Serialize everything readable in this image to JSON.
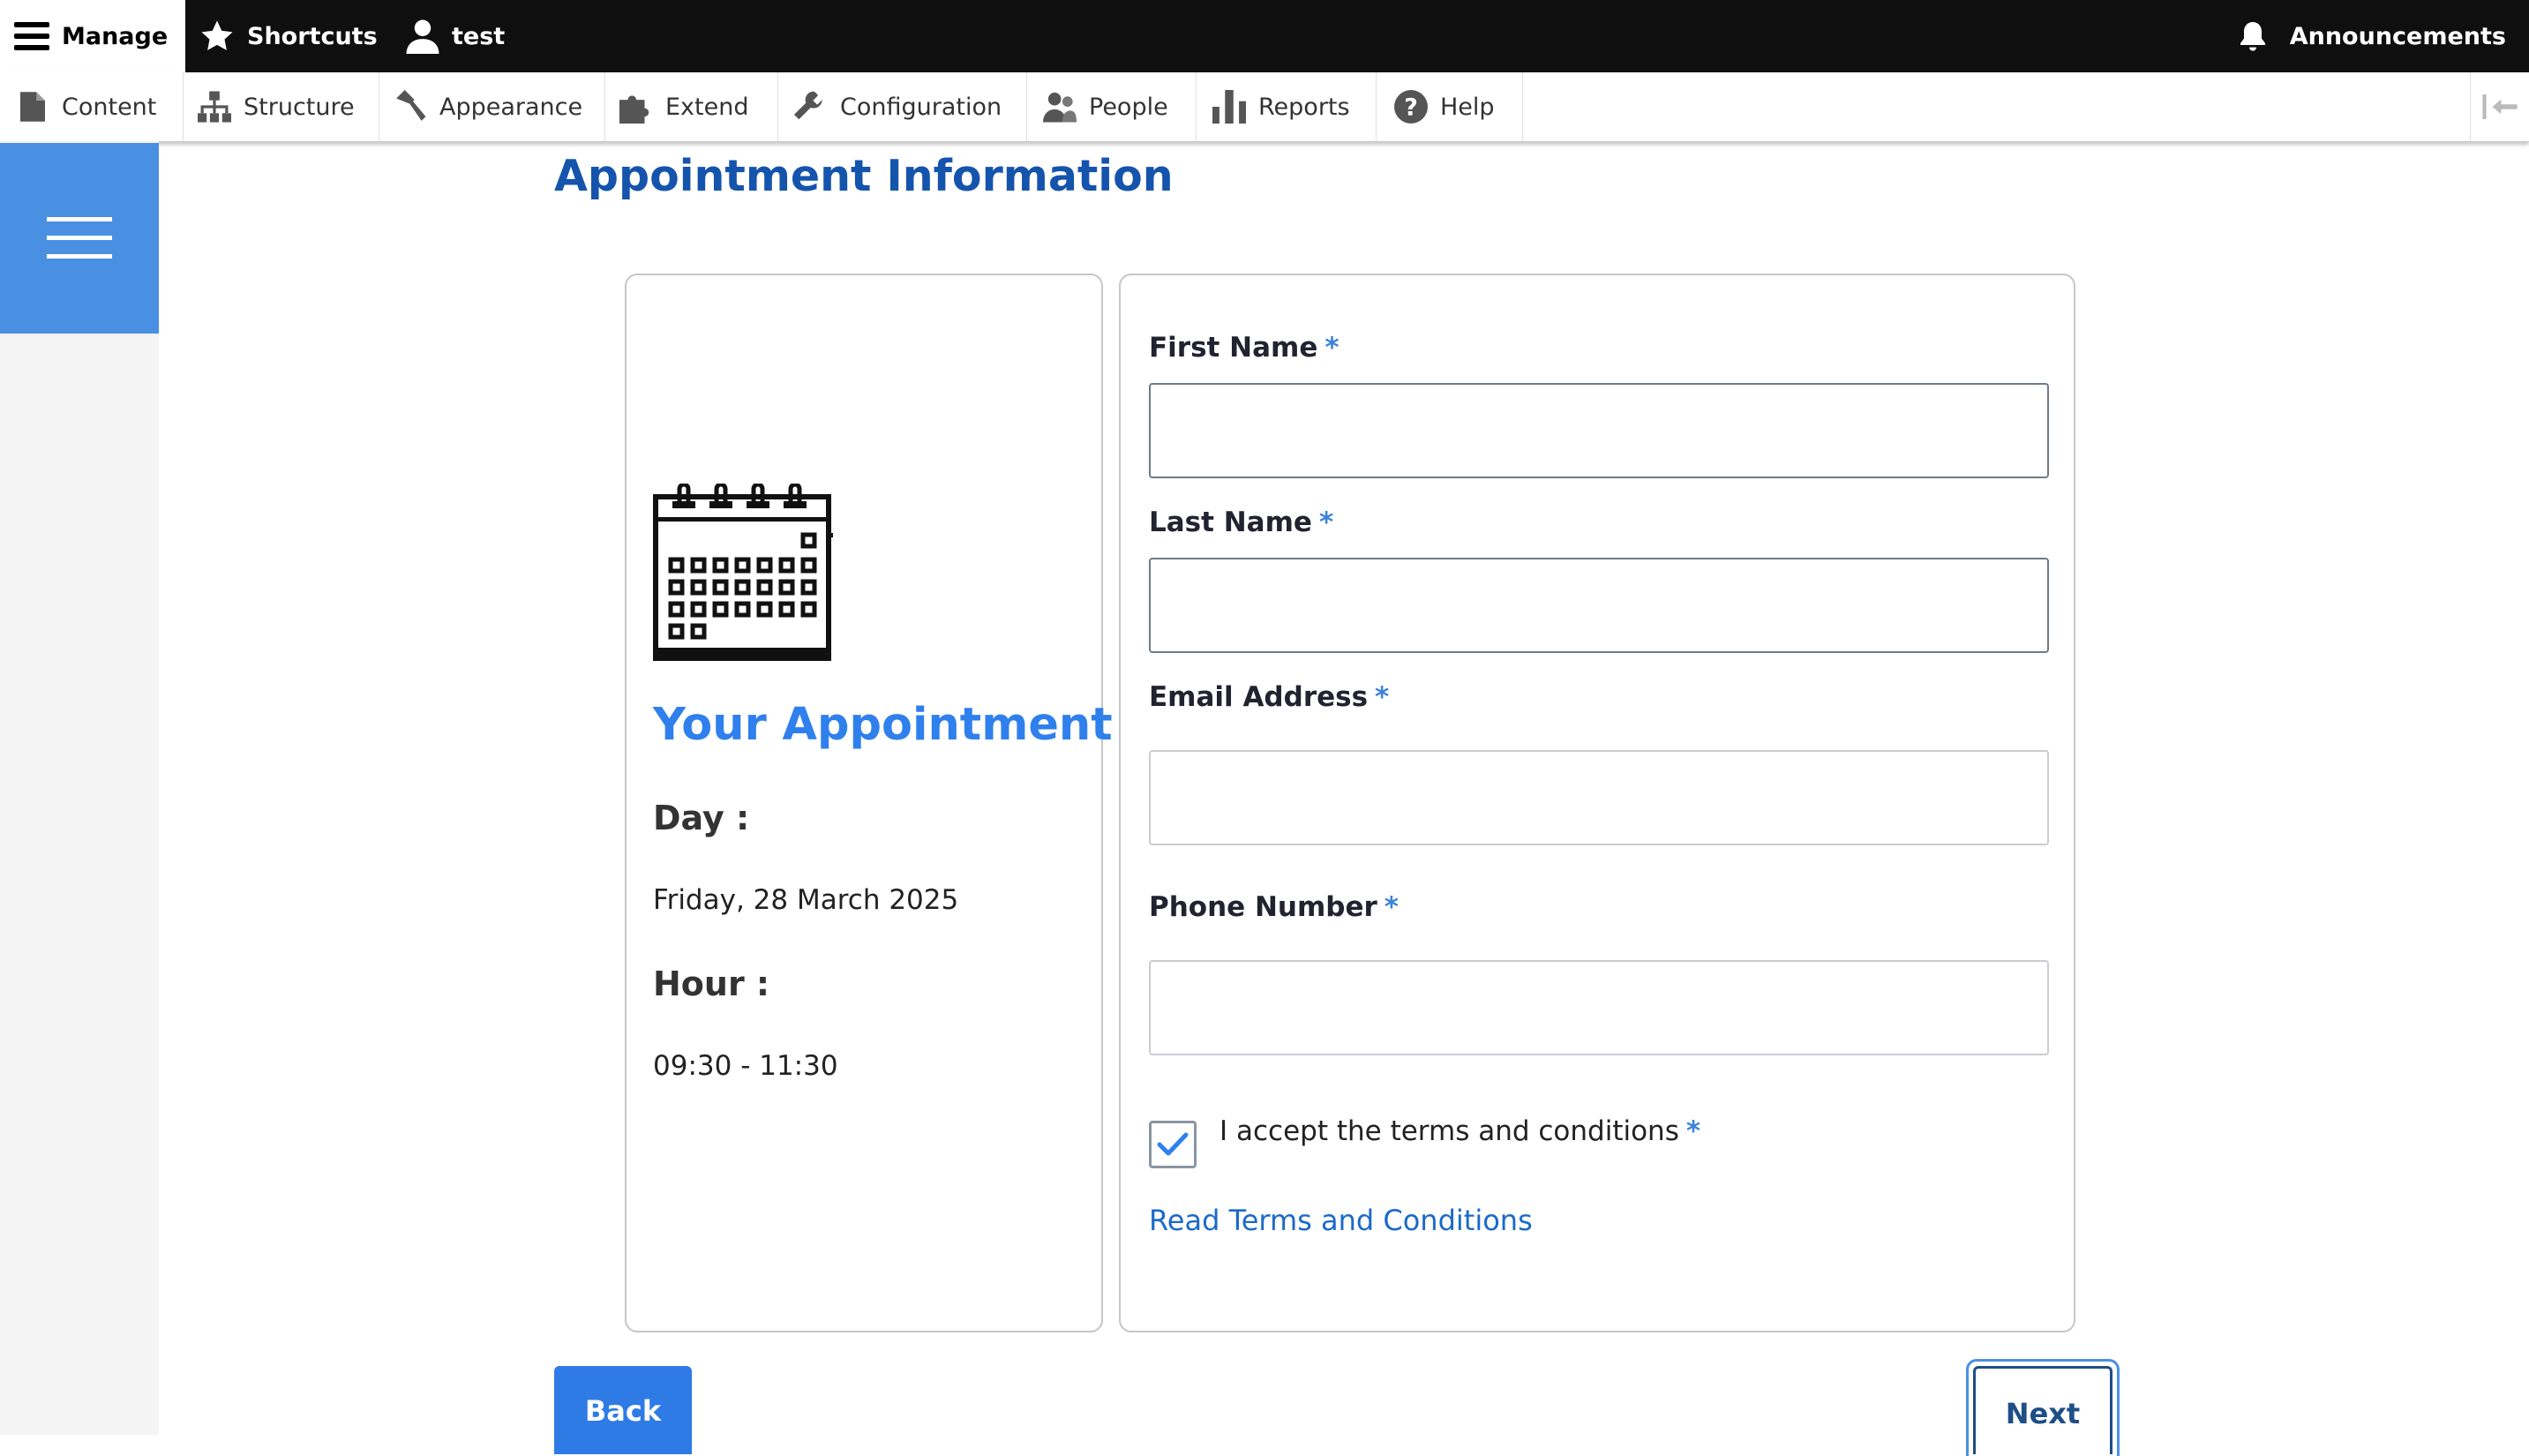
{
  "toolbar": {
    "manage_label": "Manage",
    "shortcuts_label": "Shortcuts",
    "user_label": "test",
    "announcements_label": "Announcements"
  },
  "admin_menu": {
    "items": [
      {
        "label": "Content",
        "icon": "document-icon"
      },
      {
        "label": "Structure",
        "icon": "hierarchy-icon"
      },
      {
        "label": "Appearance",
        "icon": "paint-brush-icon"
      },
      {
        "label": "Extend",
        "icon": "puzzle-icon"
      },
      {
        "label": "Configuration",
        "icon": "wrench-icon"
      },
      {
        "label": "People",
        "icon": "people-icon"
      },
      {
        "label": "Reports",
        "icon": "bar-chart-icon"
      },
      {
        "label": "Help",
        "icon": "question-icon"
      }
    ]
  },
  "page": {
    "title": "Appointment Information"
  },
  "appointment": {
    "heading": "Your Appointment",
    "day_label": "Day :",
    "day_value": "Friday, 28 March 2025",
    "hour_label": "Hour :",
    "hour_value": "09:30 - 11:30"
  },
  "form": {
    "required_marker": "*",
    "first_name_label": "First Name",
    "last_name_label": "Last Name",
    "email_label": "Email Address",
    "phone_label": "Phone Number",
    "first_name_value": "",
    "last_name_value": "",
    "email_value": "",
    "phone_value": "",
    "terms_label": "I accept the terms and conditions",
    "terms_checked": true,
    "terms_link": "Read Terms and Conditions"
  },
  "buttons": {
    "back_label": "Back",
    "next_label": "Next"
  },
  "colors": {
    "accent_blue": "#2f80ed",
    "heading_blue": "#1554ad",
    "sidebar_blue": "#4a90e2",
    "toolbar_black": "#0f0f0f"
  }
}
